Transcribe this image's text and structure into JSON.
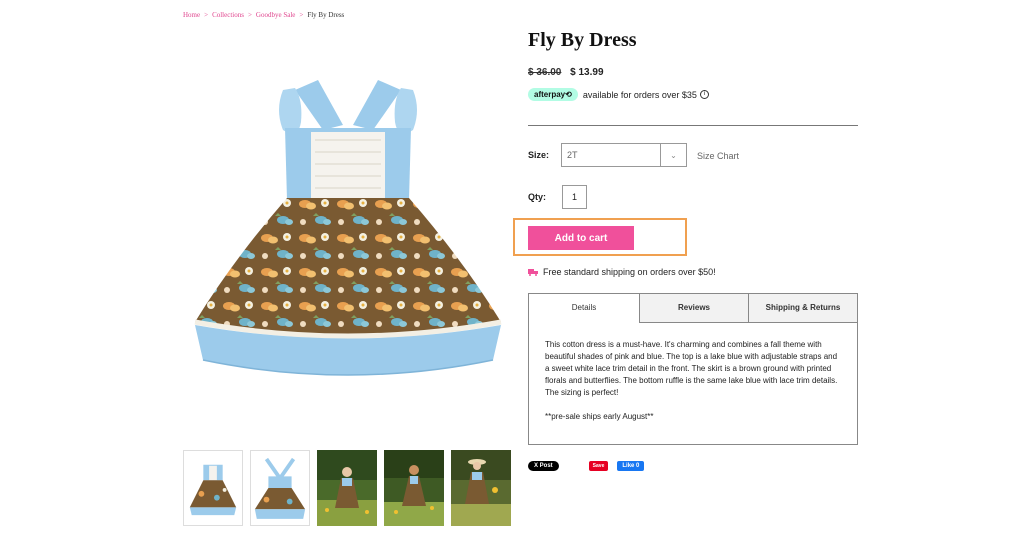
{
  "breadcrumb": {
    "items": [
      "Home",
      "Collections",
      "Goodbye Sale"
    ],
    "separator": ">",
    "current": "Fly By Dress"
  },
  "product": {
    "title": "Fly By Dress",
    "price_old": "$ 36.00",
    "price_new": "$ 13.99",
    "afterpay_logo": "afterpay⟲",
    "afterpay_text": "available for orders over $35",
    "info_icon": "i"
  },
  "options": {
    "size_label": "Size:",
    "size_value": "2T",
    "size_chart": "Size Chart",
    "qty_label": "Qty:",
    "qty_value": "1"
  },
  "cart": {
    "button_label": "Add to cart"
  },
  "shipping": {
    "text": "Free standard shipping on orders over $50!",
    "icon": "truck-icon"
  },
  "tabs": {
    "labels": [
      "Details",
      "Reviews",
      "Shipping & Returns"
    ],
    "active": 0,
    "details_text": "This cotton dress is a must-have. It's charming and combines a fall theme with beautiful shades of pink and blue. The top is a lake blue with adjustable straps and a sweet white lace trim detail in the front. The skirt is a brown ground with printed florals and butterflies. The bottom ruffle is the same lake blue with lace trim details. The sizing is perfect!",
    "presale_text": "**pre-sale ships early August**"
  },
  "social": {
    "post": "X Post",
    "save": "Save",
    "like": "Like 0"
  },
  "colors": {
    "accent_pink": "#f0509b",
    "link_pink": "#e0458e",
    "afterpay_mint": "#b2fce4",
    "dress_blue": "#9ccbeb",
    "skirt_brown": "#7a5a32",
    "highlight_orange": "#f0a050"
  }
}
